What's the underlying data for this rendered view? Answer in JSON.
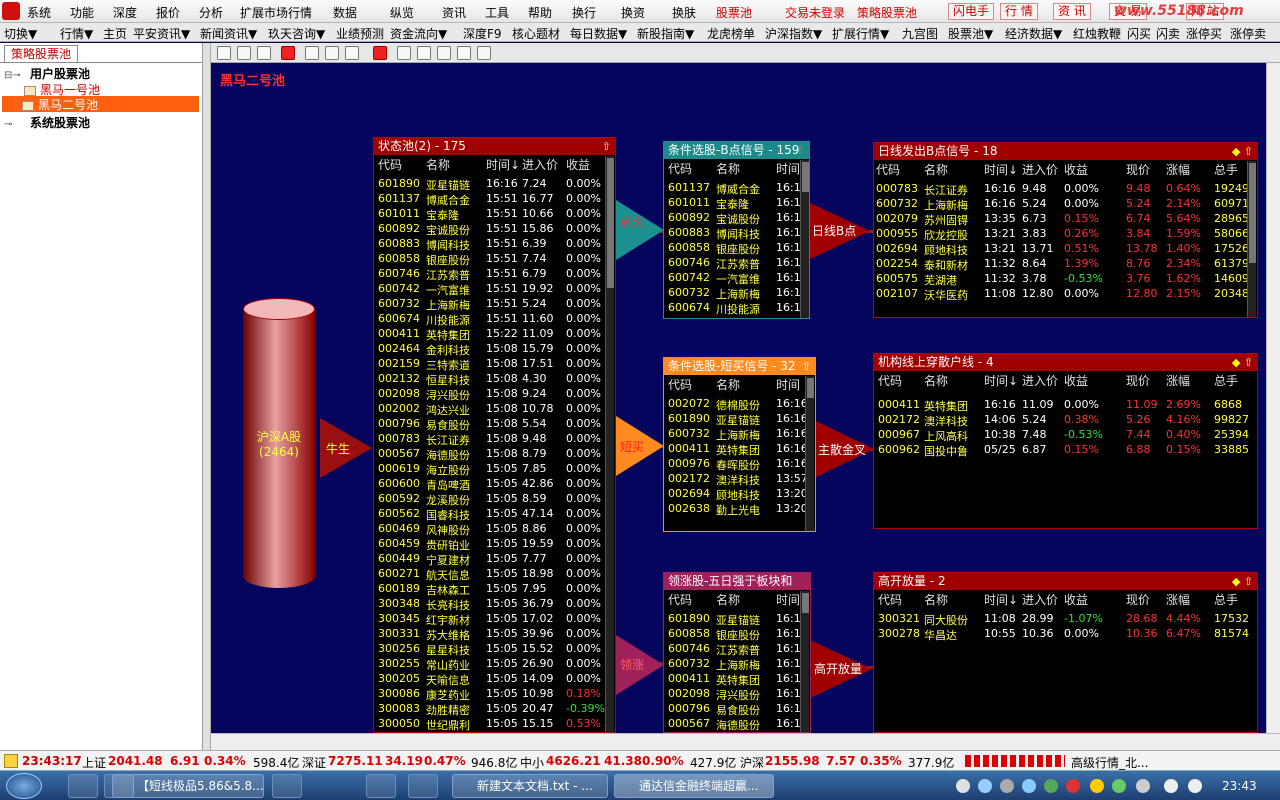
{
  "menu": {
    "items": [
      "系统",
      "功能",
      "深度",
      "报价",
      "分析",
      "扩展市场行情",
      "数据",
      "纵览",
      "资讯",
      "工具",
      "帮助",
      "换行",
      "换资",
      "换肤"
    ],
    "red_items": [
      "股票池",
      "交易未登录",
      "策略股票池"
    ],
    "boxed": [
      "闪电手",
      "行 情",
      "资 讯",
      "交 易",
      "网 站"
    ],
    "brand": "www.55188.com"
  },
  "toolbar": {
    "items": [
      "切换▼",
      "行情▼",
      "主页",
      "平安资讯▼",
      "新闻资讯▼",
      "玖天咨询▼",
      "业绩预测",
      "资金流向▼",
      "深度F9",
      "核心题材",
      "每日数据▼",
      "新股指南▼",
      "龙虎榜单",
      "沪深指数▼",
      "扩展行情▼",
      "九宫图",
      "股票池▼",
      "经济数据▼",
      "红烛教鞭",
      "闪买",
      "闪卖",
      "涨停买",
      "涨停卖"
    ]
  },
  "left": {
    "tab": "策略股票池",
    "tree": {
      "user": "用户股票池",
      "pool1": "黑马一号池",
      "pool2": "黑马二号池",
      "system": "系统股票池"
    }
  },
  "canvas_title": "黑马二号池",
  "source": {
    "name": "沪深A股",
    "count": "(2464)"
  },
  "flows": {
    "niusheng": "牛生",
    "dianhuo": "点火",
    "duanmai": "短买",
    "lingzhang": "领涨",
    "rixian_b": "日线B点",
    "zhusan": "主散金叉",
    "gaokai": "高开放量"
  },
  "pools": {
    "state": {
      "title": "状态池(2) - 175",
      "cols": [
        "代码",
        "名称",
        "时间↓",
        "进入价",
        "收益"
      ],
      "rows": [
        [
          "601890",
          "亚星锚链",
          "16:16",
          "7.24",
          "0.00%",
          "z"
        ],
        [
          "601137",
          "博威合金",
          "15:51",
          "16.77",
          "0.00%",
          "z"
        ],
        [
          "601011",
          "宝泰隆",
          "15:51",
          "10.66",
          "0.00%",
          "z"
        ],
        [
          "600892",
          "宝诚股份",
          "15:51",
          "15.86",
          "0.00%",
          "z"
        ],
        [
          "600883",
          "博闻科技",
          "15:51",
          "6.39",
          "0.00%",
          "z"
        ],
        [
          "600858",
          "银座股份",
          "15:51",
          "7.74",
          "0.00%",
          "z"
        ],
        [
          "600746",
          "江苏索普",
          "15:51",
          "6.79",
          "0.00%",
          "z"
        ],
        [
          "600742",
          "一汽富维",
          "15:51",
          "19.92",
          "0.00%",
          "z"
        ],
        [
          "600732",
          "上海新梅",
          "15:51",
          "5.24",
          "0.00%",
          "z"
        ],
        [
          "600674",
          "川投能源",
          "15:51",
          "11.60",
          "0.00%",
          "z"
        ],
        [
          "000411",
          "英特集团",
          "15:22",
          "11.09",
          "0.00%",
          "z"
        ],
        [
          "002464",
          "金利科技",
          "15:08",
          "15.79",
          "0.00%",
          "z"
        ],
        [
          "002159",
          "三特索道",
          "15:08",
          "17.51",
          "0.00%",
          "z"
        ],
        [
          "002132",
          "恒星科技",
          "15:08",
          "4.30",
          "0.00%",
          "z"
        ],
        [
          "002098",
          "浔兴股份",
          "15:08",
          "9.24",
          "0.00%",
          "z"
        ],
        [
          "002002",
          "鸿达兴业",
          "15:08",
          "10.78",
          "0.00%",
          "z"
        ],
        [
          "000796",
          "易食股份",
          "15:08",
          "5.54",
          "0.00%",
          "z"
        ],
        [
          "000783",
          "长江证券",
          "15:08",
          "9.48",
          "0.00%",
          "z"
        ],
        [
          "000567",
          "海德股份",
          "15:08",
          "8.79",
          "0.00%",
          "z"
        ],
        [
          "000619",
          "海立股份",
          "15:05",
          "7.85",
          "0.00%",
          "z"
        ],
        [
          "600600",
          "青岛啤酒",
          "15:05",
          "42.86",
          "0.00%",
          "z"
        ],
        [
          "600592",
          "龙溪股份",
          "15:05",
          "8.59",
          "0.00%",
          "z"
        ],
        [
          "600562",
          "国睿科技",
          "15:05",
          "47.14",
          "0.00%",
          "z"
        ],
        [
          "600469",
          "风神股份",
          "15:05",
          "8.86",
          "0.00%",
          "z"
        ],
        [
          "600459",
          "贵研铂业",
          "15:05",
          "19.59",
          "0.00%",
          "z"
        ],
        [
          "600449",
          "宁夏建材",
          "15:05",
          "7.77",
          "0.00%",
          "z"
        ],
        [
          "600271",
          "航天信息",
          "15:05",
          "18.98",
          "0.00%",
          "z"
        ],
        [
          "600189",
          "吉林森工",
          "15:05",
          "7.95",
          "0.00%",
          "z"
        ],
        [
          "300348",
          "长亮科技",
          "15:05",
          "36.79",
          "0.00%",
          "z"
        ],
        [
          "300345",
          "红宇新材",
          "15:05",
          "17.02",
          "0.00%",
          "z"
        ],
        [
          "300331",
          "苏大维格",
          "15:05",
          "39.96",
          "0.00%",
          "z"
        ],
        [
          "300256",
          "星星科技",
          "15:05",
          "15.52",
          "0.00%",
          "z"
        ],
        [
          "300255",
          "常山药业",
          "15:05",
          "26.90",
          "0.00%",
          "z"
        ],
        [
          "300205",
          "天喻信息",
          "15:05",
          "14.09",
          "0.00%",
          "z"
        ],
        [
          "300086",
          "康芝药业",
          "15:05",
          "10.98",
          "0.18%",
          "u"
        ],
        [
          "300083",
          "劲胜精密",
          "15:05",
          "20.47",
          "-0.39%",
          "d"
        ],
        [
          "300050",
          "世纪鼎利",
          "15:05",
          "15.15",
          "0.53%",
          "u"
        ]
      ]
    },
    "cond_b": {
      "title": "条件选股-B点信号 - 159",
      "cols": [
        "代码",
        "名称",
        "时间"
      ],
      "rows": [
        [
          "601137",
          "博威合金",
          "16:1"
        ],
        [
          "601011",
          "宝泰隆",
          "16:1"
        ],
        [
          "600892",
          "宝诚股份",
          "16:1"
        ],
        [
          "600883",
          "博闻科技",
          "16:1"
        ],
        [
          "600858",
          "银座股份",
          "16:1"
        ],
        [
          "600746",
          "江苏索普",
          "16:1"
        ],
        [
          "600742",
          "一汽富维",
          "16:1"
        ],
        [
          "600732",
          "上海新梅",
          "16:1"
        ],
        [
          "600674",
          "川投能源",
          "16:1"
        ]
      ]
    },
    "cond_short": {
      "title": "条件选股-短买信号 - 32",
      "cols": [
        "代码",
        "名称",
        "时间"
      ],
      "rows": [
        [
          "002072",
          "德棉股份",
          "16:16"
        ],
        [
          "601890",
          "亚星锚链",
          "16:16"
        ],
        [
          "600732",
          "上海新梅",
          "16:16"
        ],
        [
          "000411",
          "英特集团",
          "16:16"
        ],
        [
          "000976",
          "春晖股份",
          "16:16"
        ],
        [
          "002172",
          "澳洋科技",
          "13:57"
        ],
        [
          "002694",
          "顾地科技",
          "13:20"
        ],
        [
          "002638",
          "勤上光电",
          "13:20"
        ]
      ]
    },
    "lead": {
      "title": "领涨股-五日强于板块和",
      "cols": [
        "代码",
        "名称",
        "时间"
      ],
      "rows": [
        [
          "601890",
          "亚星锚链",
          "16:16"
        ],
        [
          "600858",
          "银座股份",
          "16:16"
        ],
        [
          "600746",
          "江苏索普",
          "16:16"
        ],
        [
          "600732",
          "上海新梅",
          "16:16"
        ],
        [
          "000411",
          "英特集团",
          "16:16"
        ],
        [
          "002098",
          "浔兴股份",
          "16:16"
        ],
        [
          "000796",
          "易食股份",
          "16:16"
        ],
        [
          "000567",
          "海德股份",
          "16:16"
        ]
      ]
    },
    "day_b": {
      "title": "日线发出B点信号 - 18",
      "cols": [
        "代码",
        "名称",
        "时间↓",
        "进入价",
        "收益",
        "现价",
        "涨幅",
        "总手"
      ],
      "rows": [
        [
          "000783",
          "长江证券",
          "16:16",
          "9.48",
          "0.00%",
          "9.48",
          "0.64%",
          "19249",
          "z"
        ],
        [
          "600732",
          "上海新梅",
          "16:16",
          "5.24",
          "0.00%",
          "5.24",
          "2.14%",
          "60971",
          "z"
        ],
        [
          "002079",
          "苏州固锝",
          "13:35",
          "6.73",
          "0.15%",
          "6.74",
          "5.64%",
          "28965",
          "u"
        ],
        [
          "000955",
          "欣龙控股",
          "13:21",
          "3.83",
          "0.26%",
          "3.84",
          "1.59%",
          "58066",
          "u"
        ],
        [
          "002694",
          "顾地科技",
          "13:21",
          "13.71",
          "0.51%",
          "13.78",
          "1.40%",
          "17526",
          "u"
        ],
        [
          "002254",
          "泰和新材",
          "11:32",
          "8.64",
          "1.39%",
          "8.76",
          "2.34%",
          "61379",
          "u"
        ],
        [
          "600575",
          "芜湖港",
          "11:32",
          "3.78",
          "-0.53%",
          "3.76",
          "1.62%",
          "14609",
          "d"
        ],
        [
          "002107",
          "沃华医药",
          "11:08",
          "12.80",
          "0.00%",
          "12.80",
          "2.15%",
          "20348",
          "z"
        ]
      ]
    },
    "inst": {
      "title": "机构线上穿散户线 - 4",
      "cols": [
        "代码",
        "名称",
        "时间↓",
        "进入价",
        "收益",
        "现价",
        "涨幅",
        "总手"
      ],
      "rows": [
        [
          "000411",
          "英特集团",
          "16:16",
          "11.09",
          "0.00%",
          "11.09",
          "2.69%",
          "6868",
          "z"
        ],
        [
          "002172",
          "澳洋科技",
          "14:06",
          "5.24",
          "0.38%",
          "5.26",
          "4.16%",
          "99827",
          "u"
        ],
        [
          "000967",
          "上风高科",
          "10:38",
          "7.48",
          "-0.53%",
          "7.44",
          "0.40%",
          "25394",
          "d"
        ],
        [
          "600962",
          "国投中鲁",
          "05/25",
          "6.87",
          "0.15%",
          "6.88",
          "0.15%",
          "33885",
          "u"
        ]
      ]
    },
    "gap": {
      "title": "高开放量 - 2",
      "cols": [
        "代码",
        "名称",
        "时间↓",
        "进入价",
        "收益",
        "现价",
        "涨幅",
        "总手"
      ],
      "rows": [
        [
          "300321",
          "同大股份",
          "11:08",
          "28.99",
          "-1.07%",
          "28.68",
          "4.44%",
          "17532",
          "d"
        ],
        [
          "300278",
          "华昌达",
          "10:55",
          "10.36",
          "0.00%",
          "10.36",
          "6.47%",
          "81574",
          "z"
        ]
      ]
    }
  },
  "status": {
    "time": "23:43:17",
    "sh_label": "上证",
    "sh_val": "2041.48",
    "sh_chg": "6.91",
    "sh_pct": "0.34%",
    "sh_amt": "598.4亿",
    "sz_label": "深证",
    "sz_val": "7275.11",
    "sz_chg": "34.19",
    "sz_pct": "0.47%",
    "sz_amt": "946.8亿",
    "zx_label": "中小",
    "zx_val": "4626.21",
    "zx_chg": "41.38",
    "zx_pct": "0.90%",
    "zx_amt": "427.9亿",
    "hs_label": "沪深",
    "hs_val": "2155.98",
    "hs_chg": "7.57",
    "hs_pct": "0.35%",
    "hs_amt": "377.9亿",
    "server": "高级行情_北..."
  },
  "taskbar": {
    "tasks": [
      "【短线极品5.86&5.8...",
      "新建文本文档.txt - ...",
      "通达信金融终端超赢..."
    ],
    "clock": "23:43"
  },
  "colors": {
    "up": "#ff3030",
    "down": "#30e030",
    "header": "#a00000"
  }
}
